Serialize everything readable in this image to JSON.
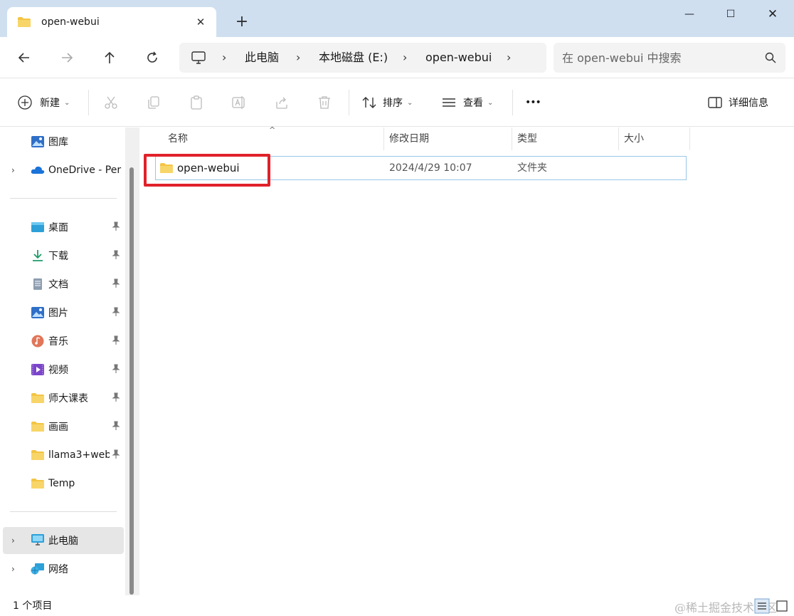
{
  "window": {
    "tab_title": "open-webui",
    "tab_close": "✕",
    "new_tab": "+",
    "minimize": "—",
    "maximize": "☐",
    "close": "✕"
  },
  "address": {
    "breadcrumb": [
      "此电脑",
      "本地磁盘 (E:)",
      "open-webui"
    ],
    "search_placeholder": "在 open-webui 中搜索"
  },
  "toolbar": {
    "new_label": "新建",
    "sort_label": "排序",
    "view_label": "查看",
    "more_label": "•••",
    "details_label": "详细信息"
  },
  "sidebar": {
    "top_items": [
      {
        "label": "图库",
        "icon": "gallery-icon"
      },
      {
        "label": "OneDrive - Per",
        "icon": "onedrive-icon"
      }
    ],
    "quick_access": [
      {
        "label": "桌面",
        "icon": "desktop-icon",
        "pinned": true
      },
      {
        "label": "下载",
        "icon": "download-icon",
        "pinned": true
      },
      {
        "label": "文档",
        "icon": "document-icon",
        "pinned": true
      },
      {
        "label": "图片",
        "icon": "pictures-icon",
        "pinned": true
      },
      {
        "label": "音乐",
        "icon": "music-icon",
        "pinned": true
      },
      {
        "label": "视频",
        "icon": "video-icon",
        "pinned": true
      },
      {
        "label": "师大课表",
        "icon": "folder-icon",
        "pinned": true
      },
      {
        "label": "画画",
        "icon": "folder-icon",
        "pinned": true
      },
      {
        "label": "llama3+web",
        "icon": "folder-icon",
        "pinned": true
      },
      {
        "label": "Temp",
        "icon": "folder-icon",
        "pinned": false
      }
    ],
    "bottom_items": [
      {
        "label": "此电脑",
        "icon": "this-pc-icon",
        "selected": true
      },
      {
        "label": "网络",
        "icon": "network-icon",
        "selected": false
      }
    ]
  },
  "content": {
    "columns": [
      "名称",
      "修改日期",
      "类型",
      "大小"
    ],
    "rows": [
      {
        "name": "open-webui",
        "modified": "2024/4/29 10:07",
        "type": "文件夹",
        "size": ""
      }
    ]
  },
  "status": {
    "item_count": "1 个项目",
    "watermark": "@稀土掘金技术社区"
  },
  "colors": {
    "titlebar": "#cfdff0",
    "highlight": "#e0212a",
    "selection_border": "#99c7e8",
    "folder": "#f3c545"
  }
}
